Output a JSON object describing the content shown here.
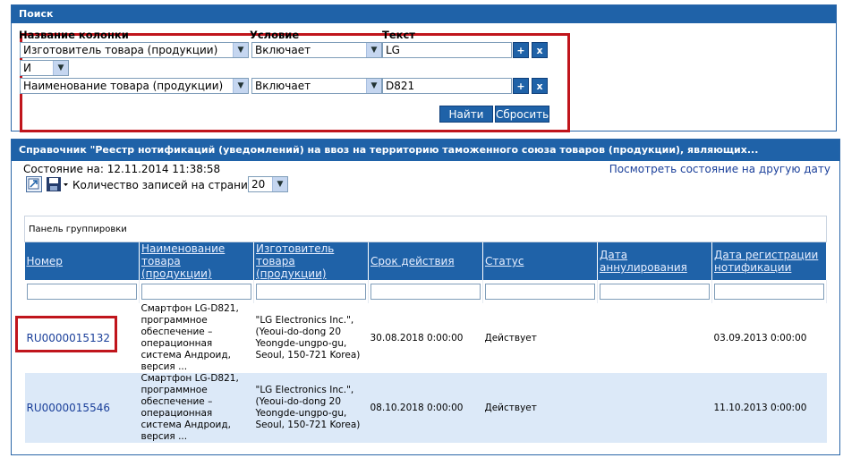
{
  "search": {
    "title": "Поиск",
    "headers": {
      "column": "Название колонки",
      "condition": "Условие",
      "text": "Текст"
    },
    "row1": {
      "column": "Изготовитель товара (продукции)",
      "condition": "Включает",
      "text": "LG",
      "add": "+",
      "remove": "x"
    },
    "joiner": "И",
    "row2": {
      "column": "Наименование товара (продукции)",
      "condition": "Включает",
      "text": "D821",
      "add": "+",
      "remove": "x"
    },
    "find_label": "Найти",
    "reset_label": "Сбросить"
  },
  "reference": {
    "title": "Справочник \"Реестр нотификаций (уведомлений) на ввоз на территорию таможенного союза товаров (продукции), являющих...",
    "state": "Состояние на: 12.11.2014 11:38:58",
    "other_date_link": "Посмотреть состояние на другую дату",
    "page_size_label": "Количество записей на странице",
    "page_size": "20",
    "group_panel": "Панель группировки",
    "columns": [
      "Номер",
      "Наименование товара (продукции)",
      "Изготовитель товара (продукции)",
      "Срок действия",
      "Статус",
      "Дата аннулирования",
      "Дата регистрации нотификации"
    ],
    "rows": [
      {
        "number": "RU0000015132",
        "name": "Смартфон LG-D821, программное обеспечение – операционная система Андроид, версия ...",
        "manufacturer": "\"LG Electronics Inc.\", (Yeoui-do-dong 20 Yeongde-ungpo-gu, Seoul, 150-721 Korea)",
        "valid_until": "30.08.2018 0:00:00",
        "status": "Действует",
        "annulled": "",
        "registered": "03.09.2013 0:00:00"
      },
      {
        "number": "RU0000015546",
        "name": "Смартфон LG-D821, программное обеспечение – операционная система Андроид, версия ...",
        "manufacturer": "\"LG Electronics Inc.\", (Yeoui-do-dong 20 Yeongde-ungpo-gu, Seoul, 150-721 Korea)",
        "valid_until": "08.10.2018 0:00:00",
        "status": "Действует",
        "annulled": "",
        "registered": "11.10.2013 0:00:00"
      }
    ]
  },
  "colors": {
    "header_blue": "#1f62a8",
    "highlight_red": "#c0151c",
    "alt_row": "#dce9f8",
    "link": "#1a3f9a"
  }
}
